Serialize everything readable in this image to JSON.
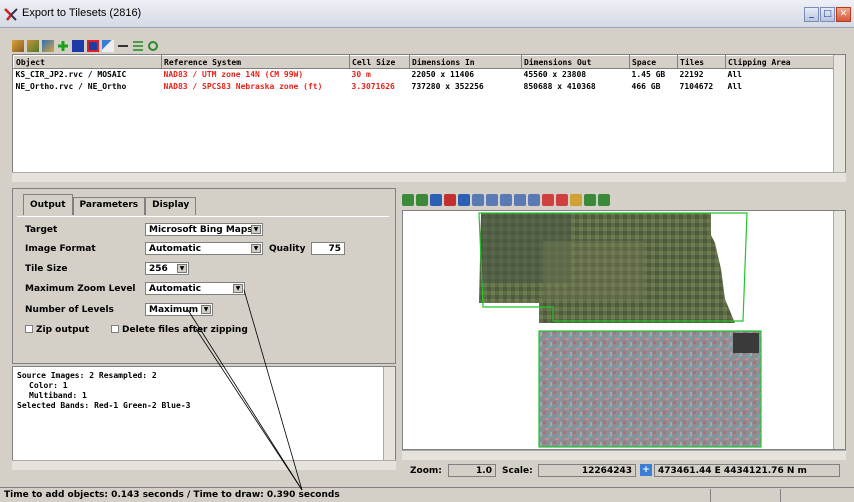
{
  "window": {
    "title": "Export to Tilesets (2816)"
  },
  "object_list": {
    "columns": [
      "Object",
      "Reference System",
      "Cell Size",
      "Dimensions In",
      "Dimensions Out",
      "Space",
      "Tiles",
      "Clipping Area"
    ],
    "rows": [
      [
        "KS_CIR_JP2.rvc / MOSAIC",
        "NAD83 / UTM zone 14N (CM 99W)",
        "30 m",
        "22050 x 11406",
        "45560 x 23808",
        "1.45 GB",
        "22192",
        "All"
      ],
      [
        "NE_Ortho.rvc / NE_Ortho",
        "NAD83 / SPCS83 Nebraska zone (ft)",
        "3.3071626",
        "737280 x 352256",
        "850688 x 410368",
        "466 GB",
        "7104672",
        "All"
      ]
    ]
  },
  "tabs": [
    "Output",
    "Parameters",
    "Display"
  ],
  "output": {
    "target_label": "Target",
    "target_value": "Microsoft Bing Maps",
    "format_label": "Image Format",
    "format_value": "Automatic",
    "quality_label": "Quality",
    "quality_value": "75",
    "tile_size_label": "Tile Size",
    "tile_size_value": "256",
    "max_zoom_label": "Maximum Zoom Level",
    "max_zoom_value": "Automatic",
    "levels_label": "Number of Levels",
    "levels_value": "Maximum",
    "zip_label": "Zip output",
    "delete_label": "Delete files after zipping"
  },
  "info": {
    "line1": "Source Images: 2  Resampled: 2",
    "line2": "Color: 1",
    "line3": "Multiband: 1",
    "line4": "Selected Bands: Red-1 Green-2 Blue-3"
  },
  "zoombar": {
    "zoom_label": "Zoom:",
    "zoom_value": "1.0",
    "scale_label": "Scale:",
    "scale_value": "12264243",
    "coords": "473461.44 E 4434121.76 N m"
  },
  "status": {
    "text": "Time to add objects: 0.143 seconds  /  Time to draw: 0.390 seconds"
  },
  "colors": {
    "accent_red": "#e8221a",
    "boundary_green": "#22c42a"
  }
}
